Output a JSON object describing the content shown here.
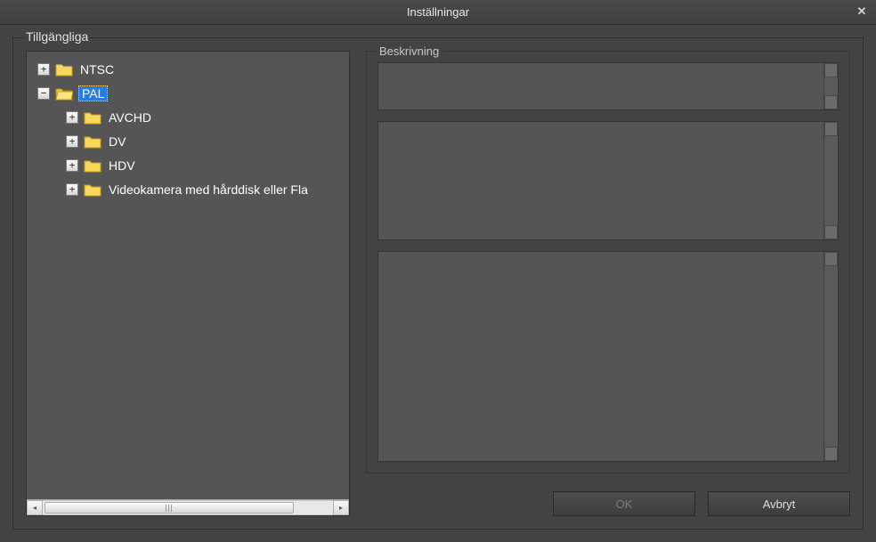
{
  "window": {
    "title": "Inställningar"
  },
  "labels": {
    "available": "Tillgängliga",
    "description": "Beskrivning"
  },
  "tree": {
    "items": [
      {
        "expander": "+",
        "label": "NTSC",
        "indent": 0,
        "selected": false
      },
      {
        "expander": "−",
        "label": "PAL",
        "indent": 0,
        "selected": true
      },
      {
        "expander": "+",
        "label": "AVCHD",
        "indent": 1,
        "selected": false
      },
      {
        "expander": "+",
        "label": "DV",
        "indent": 1,
        "selected": false
      },
      {
        "expander": "+",
        "label": "HDV",
        "indent": 1,
        "selected": false
      },
      {
        "expander": "+",
        "label": "Videokamera med hårddisk eller Fla",
        "indent": 1,
        "selected": false
      }
    ]
  },
  "buttons": {
    "ok": "OK",
    "cancel": "Avbryt"
  }
}
